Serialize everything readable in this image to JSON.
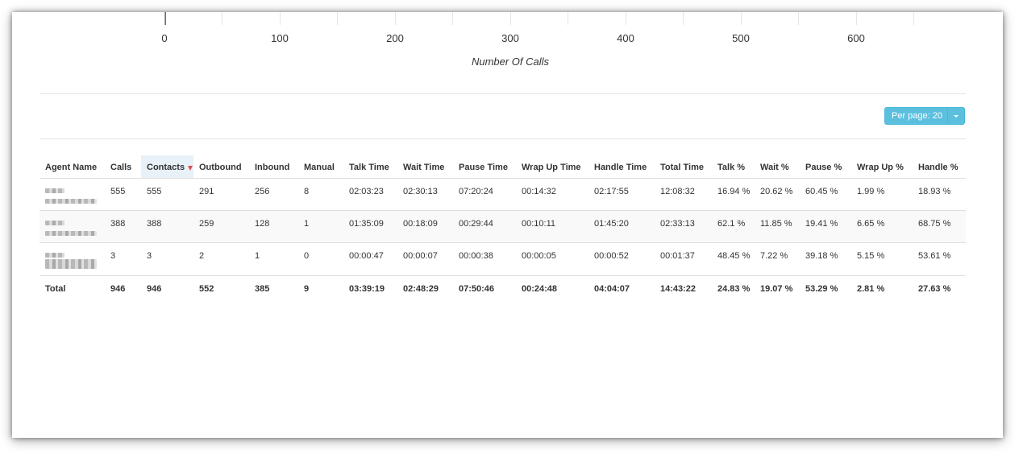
{
  "chart": {
    "x_ticks": [
      "0",
      "100",
      "200",
      "300",
      "400",
      "500",
      "600"
    ],
    "x_title": "Number Of Calls"
  },
  "toolbar": {
    "per_page_label": "Per page: 20"
  },
  "table": {
    "columns": [
      "Agent Name",
      "Calls",
      "Contacts",
      "Outbound",
      "Inbound",
      "Manual",
      "Talk Time",
      "Wait Time",
      "Pause Time",
      "Wrap Up Time",
      "Handle Time",
      "Total Time",
      "Talk %",
      "Wait %",
      "Pause %",
      "Wrap Up %",
      "Handle %"
    ],
    "sorted_column": "Contacts",
    "rows": [
      {
        "agent": "",
        "cells": [
          "555",
          "555",
          "291",
          "256",
          "8",
          "02:03:23",
          "02:30:13",
          "07:20:24",
          "00:14:32",
          "02:17:55",
          "12:08:32",
          "16.94 %",
          "20.62 %",
          "60.45 %",
          "1.99 %",
          "18.93 %"
        ]
      },
      {
        "agent": "",
        "cells": [
          "388",
          "388",
          "259",
          "128",
          "1",
          "01:35:09",
          "00:18:09",
          "00:29:44",
          "00:10:11",
          "01:45:20",
          "02:33:13",
          "62.1 %",
          "11.85 %",
          "19.41 %",
          "6.65 %",
          "68.75 %"
        ]
      },
      {
        "agent": "",
        "cells": [
          "3",
          "3",
          "2",
          "1",
          "0",
          "00:00:47",
          "00:00:07",
          "00:00:38",
          "00:00:05",
          "00:00:52",
          "00:01:37",
          "48.45 %",
          "7.22 %",
          "39.18 %",
          "5.15 %",
          "53.61 %"
        ]
      }
    ],
    "total": {
      "label": "Total",
      "cells": [
        "946",
        "946",
        "552",
        "385",
        "9",
        "03:39:19",
        "02:48:29",
        "07:50:46",
        "00:24:48",
        "04:04:07",
        "14:43:22",
        "24.83 %",
        "19.07 %",
        "53.29 %",
        "2.81 %",
        "27.63 %"
      ]
    }
  },
  "colors": {
    "accent": "#5bc0de",
    "sort_indicator": "#d9534f",
    "zero_bar": "#c0504d"
  }
}
